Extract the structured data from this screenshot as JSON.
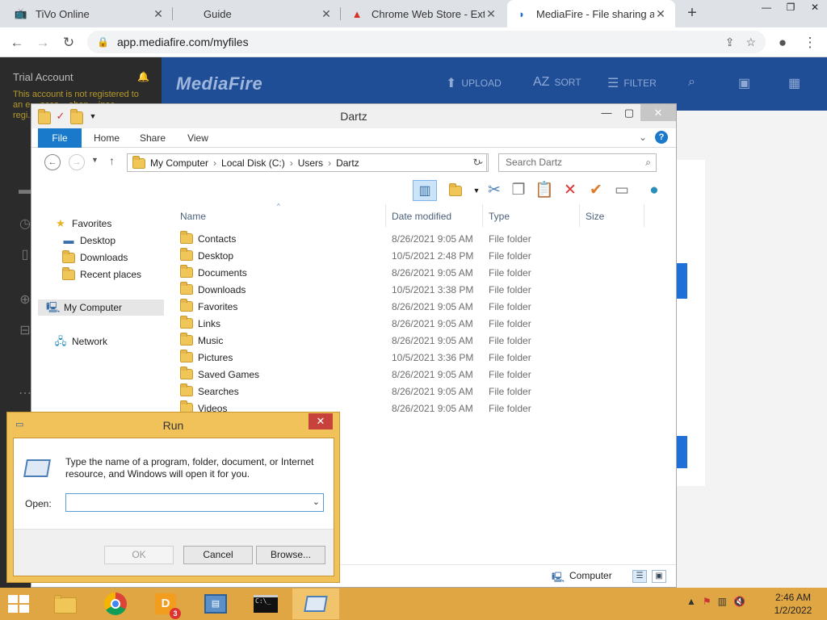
{
  "browser": {
    "tabs": [
      {
        "title": "TiVo Online",
        "icon": "tivo-icon"
      },
      {
        "title": "Guide",
        "icon": "apple-icon"
      },
      {
        "title": "Chrome Web Store - Exten",
        "icon": "chrome-webstore-icon"
      },
      {
        "title": "MediaFire - File sharing an",
        "icon": "mediafire-icon",
        "active": true
      }
    ],
    "url": "app.mediafire.com/myfiles"
  },
  "mediafire": {
    "account_title": "Trial Account",
    "warning_text": "This account is not registered to an e... acco... aban... inac... regi...",
    "logo": "MediaFire",
    "actions": {
      "upload": "UPLOAD",
      "sort": "SORT",
      "filter": "FILTER"
    }
  },
  "explorer": {
    "title": "Dartz",
    "ribbon_tabs": [
      "File",
      "Home",
      "Share",
      "View"
    ],
    "breadcrumb": [
      "My Computer",
      "Local Disk (C:)",
      "Users",
      "Dartz"
    ],
    "search_placeholder": "Search Dartz",
    "nav": {
      "favorites": "Favorites",
      "desktop": "Desktop",
      "downloads": "Downloads",
      "recent": "Recent places",
      "computer": "My Computer",
      "network": "Network"
    },
    "columns": {
      "name": "Name",
      "date": "Date modified",
      "type": "Type",
      "size": "Size"
    },
    "files": [
      {
        "name": "Contacts",
        "date": "8/26/2021 9:05 AM",
        "type": "File folder"
      },
      {
        "name": "Desktop",
        "date": "10/5/2021 2:48 PM",
        "type": "File folder"
      },
      {
        "name": "Documents",
        "date": "8/26/2021 9:05 AM",
        "type": "File folder"
      },
      {
        "name": "Downloads",
        "date": "10/5/2021 3:38 PM",
        "type": "File folder"
      },
      {
        "name": "Favorites",
        "date": "8/26/2021 9:05 AM",
        "type": "File folder"
      },
      {
        "name": "Links",
        "date": "8/26/2021 9:05 AM",
        "type": "File folder"
      },
      {
        "name": "Music",
        "date": "8/26/2021 9:05 AM",
        "type": "File folder"
      },
      {
        "name": "Pictures",
        "date": "10/5/2021 3:36 PM",
        "type": "File folder"
      },
      {
        "name": "Saved Games",
        "date": "8/26/2021 9:05 AM",
        "type": "File folder"
      },
      {
        "name": "Searches",
        "date": "8/26/2021 9:05 AM",
        "type": "File folder"
      },
      {
        "name": "Videos",
        "date": "8/26/2021 9:05 AM",
        "type": "File folder"
      }
    ],
    "status_location": "Computer"
  },
  "run": {
    "title": "Run",
    "message": "Type the name of a program, folder, document, or Internet resource, and Windows will open it for you.",
    "open_label": "Open:",
    "open_value": "",
    "ok": "OK",
    "cancel": "Cancel",
    "browse": "Browse..."
  },
  "taskbar": {
    "badge_count": "3",
    "time": "2:46 AM",
    "date": "1/2/2022"
  },
  "colors": {
    "mediafire_blue": "#1f4e96",
    "taskbar": "#e0a643",
    "ribbon_file": "#1979ca"
  }
}
